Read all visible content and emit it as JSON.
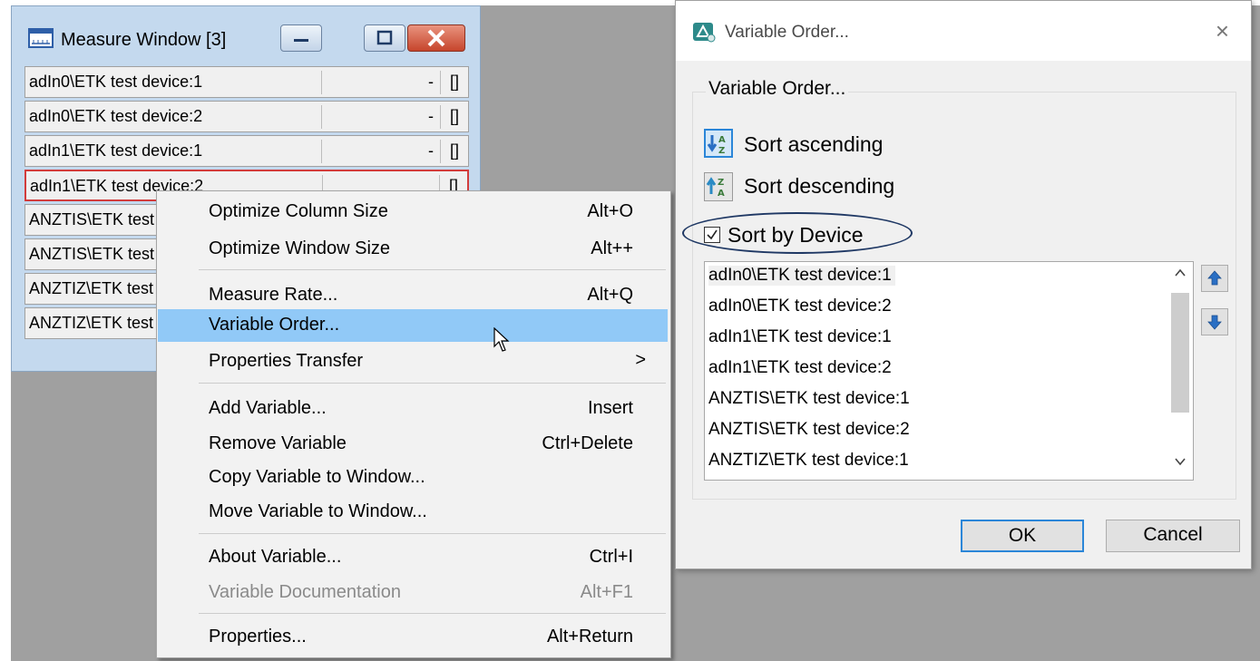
{
  "measure_window": {
    "title": "Measure Window [3]",
    "rows": [
      {
        "name": "adIn0\\ETK test device:1",
        "value": "-",
        "unit": "[]"
      },
      {
        "name": "adIn0\\ETK test device:2",
        "value": "-",
        "unit": "[]"
      },
      {
        "name": "adIn1\\ETK test device:1",
        "value": "-",
        "unit": "[]"
      },
      {
        "name": "adIn1\\ETK test device:2",
        "value": "",
        "unit": "[]"
      },
      {
        "name": "ANZTIS\\ETK test device:1",
        "value": "",
        "unit": ""
      },
      {
        "name": "ANZTIS\\ETK test device:2",
        "value": "",
        "unit": ""
      },
      {
        "name": "ANZTIZ\\ETK test device:1",
        "value": "",
        "unit": ""
      },
      {
        "name": "ANZTIZ\\ETK test device:2",
        "value": "",
        "unit": ""
      }
    ]
  },
  "context_menu": {
    "items": [
      {
        "label": "Optimize Column Size",
        "shortcut": "Alt+O"
      },
      {
        "label": "Optimize Window Size",
        "shortcut": "Alt++"
      },
      {
        "label": "Measure Rate...",
        "shortcut": "Alt+Q"
      },
      {
        "label": "Variable Order...",
        "shortcut": ""
      },
      {
        "label": "Properties Transfer",
        "shortcut": ">"
      },
      {
        "label": "Add Variable...",
        "shortcut": "Insert"
      },
      {
        "label": "Remove Variable",
        "shortcut": "Ctrl+Delete"
      },
      {
        "label": "Copy Variable to Window...",
        "shortcut": ""
      },
      {
        "label": "Move Variable to Window...",
        "shortcut": ""
      },
      {
        "label": "About Variable...",
        "shortcut": "Ctrl+I"
      },
      {
        "label": "Variable Documentation",
        "shortcut": "Alt+F1"
      },
      {
        "label": "Properties...",
        "shortcut": "Alt+Return"
      }
    ]
  },
  "dialog": {
    "title": "Variable Order...",
    "close_glyph": "×",
    "group_title": "Variable Order...",
    "sort_ascending": "Sort ascending",
    "sort_descending": "Sort descending",
    "sort_by_device": "Sort by Device",
    "sort_by_device_checked": true,
    "list": [
      "adIn0\\ETK test device:1",
      "adIn0\\ETK test device:2",
      "adIn1\\ETK test device:1",
      "adIn1\\ETK test device:2",
      "ANZTIS\\ETK test device:1",
      "ANZTIS\\ETK test device:2",
      "ANZTIZ\\ETK test device:1"
    ],
    "ok_label": "OK",
    "cancel_label": "Cancel"
  },
  "colors": {
    "accent": "#2b86d8",
    "menu_highlight": "#91c9f7",
    "selection_border": "#d23c3c"
  }
}
